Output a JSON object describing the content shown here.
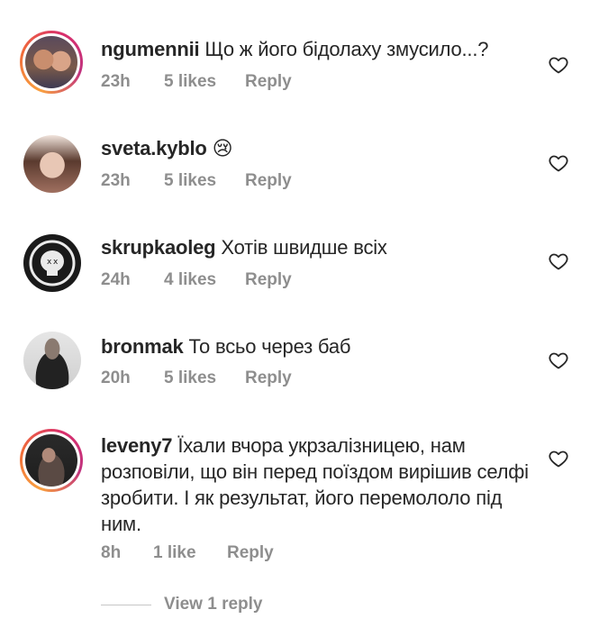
{
  "comments": [
    {
      "username": "ngumennii",
      "text": "Що ж його бідолаху змусило...?",
      "time": "23h",
      "likes": "5 likes",
      "reply": "Reply",
      "story_ring": true,
      "avatar_colors": [
        "#7a5a4a",
        "#c98e6e",
        "#3d3a52"
      ]
    },
    {
      "username": "sveta.kyblo",
      "text": "😢",
      "time": "23h",
      "likes": "5 likes",
      "reply": "Reply",
      "story_ring": false,
      "avatar_colors": [
        "#e8c7b5",
        "#a07060",
        "#5a3a2e"
      ]
    },
    {
      "username": "skrupkaoleg",
      "text": "Хотів швидше всіх",
      "time": "24h",
      "likes": "4 likes",
      "reply": "Reply",
      "story_ring": false,
      "avatar_colors": [
        "#1a1a1a",
        "#eaeaea",
        "#444444"
      ]
    },
    {
      "username": "bronmak",
      "text": "То всьо через баб",
      "time": "20h",
      "likes": "5 likes",
      "reply": "Reply",
      "story_ring": false,
      "avatar_colors": [
        "#d9d9d9",
        "#222222",
        "#8a7a70"
      ]
    },
    {
      "username": "leveny7",
      "text": "Їхали вчора укрзалізницею, нам розповіли, що він перед поїздом вирішив селфі зробити. І як результат, його перемололо під ним.",
      "time": "8h",
      "likes": "1 like",
      "reply": "Reply",
      "story_ring": true,
      "avatar_colors": [
        "#1e1e1e",
        "#5a4a44",
        "#b08a7a"
      ]
    }
  ],
  "view_replies": "View 1 reply",
  "icons": {
    "like": "heart-outline-icon"
  },
  "colors": {
    "text": "#262626",
    "secondary": "#8e8e8e",
    "heart": "#262626"
  }
}
